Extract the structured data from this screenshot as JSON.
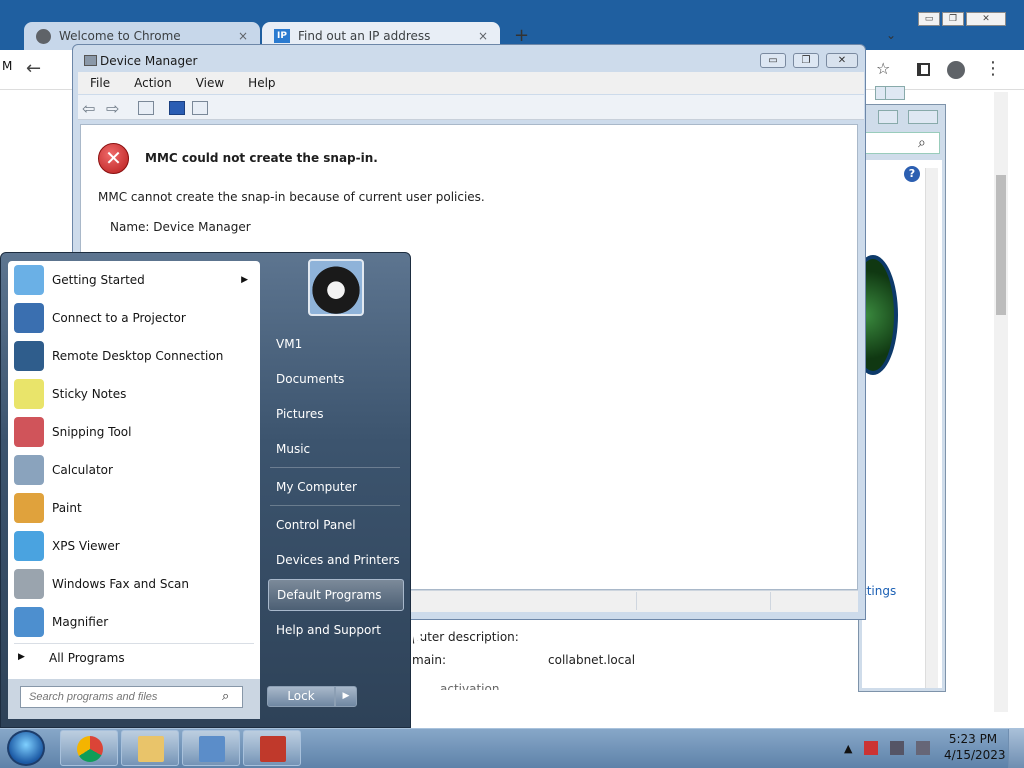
{
  "chrome": {
    "tabs": [
      {
        "title": "Welcome to Chrome",
        "close": "×"
      },
      {
        "title": "Find out an IP address",
        "close": "×"
      }
    ],
    "new_tab": "+",
    "dropdown": "⌄",
    "window_buttons": {
      "minimize": "▭",
      "restore": "❐",
      "close": "✕"
    },
    "back": "←",
    "star": "☆",
    "menu": "⋮",
    "left_letter": "M"
  },
  "device_manager": {
    "title": "Device Manager",
    "menu": [
      "File",
      "Action",
      "View",
      "Help"
    ],
    "buttons": {
      "minimize": "▭",
      "restore": "❐",
      "close": "✕"
    },
    "error_title": "MMC could not create the snap-in.",
    "error_message": "MMC cannot create the snap-in because of current user policies.",
    "error_name": "Name: Device Manager"
  },
  "background_window": {
    "help": "?",
    "link_partial": "ttings",
    "search_icon": "⌕"
  },
  "control_panel": {
    "desc_label": "puter description:",
    "domain_label": "main:",
    "domain_value": "collabnet.local",
    "cut_text": "activation"
  },
  "start_menu": {
    "programs": [
      {
        "label": "Getting Started",
        "icon": "getting-started-icon",
        "has_arrow": true,
        "color": "#6ab0e6"
      },
      {
        "label": "Connect to a Projector",
        "icon": "projector-icon",
        "color": "#3a6fb0"
      },
      {
        "label": "Remote Desktop Connection",
        "icon": "remote-desktop-icon",
        "color": "#2f5d8c"
      },
      {
        "label": "Sticky Notes",
        "icon": "sticky-notes-icon",
        "color": "#e9e46a"
      },
      {
        "label": "Snipping Tool",
        "icon": "snipping-tool-icon",
        "color": "#d0545a"
      },
      {
        "label": "Calculator",
        "icon": "calculator-icon",
        "color": "#8aa3bd"
      },
      {
        "label": "Paint",
        "icon": "paint-icon",
        "color": "#e0a23c"
      },
      {
        "label": "XPS Viewer",
        "icon": "xps-viewer-icon",
        "color": "#4aa3e0"
      },
      {
        "label": "Windows Fax and Scan",
        "icon": "fax-scan-icon",
        "color": "#9aa4ae"
      },
      {
        "label": "Magnifier",
        "icon": "magnifier-icon",
        "color": "#4d8fcf"
      }
    ],
    "arrow_glyph": "▶",
    "all_programs": "All Programs",
    "search_placeholder": "Search programs and files",
    "search_icon": "⌕",
    "right_links": [
      "VM1",
      "Documents",
      "Pictures",
      "Music",
      "My Computer",
      "Control Panel",
      "Devices and Printers",
      "Default Programs",
      "Help and Support"
    ],
    "lock_label": "Lock",
    "lock_arrow": "▶"
  },
  "taskbar": {
    "clock_time": "5:23 PM",
    "clock_date": "4/15/2023",
    "tray_chevron": "▲",
    "tray_icons": [
      "flag-icon",
      "network-icon",
      "volume-icon"
    ]
  }
}
